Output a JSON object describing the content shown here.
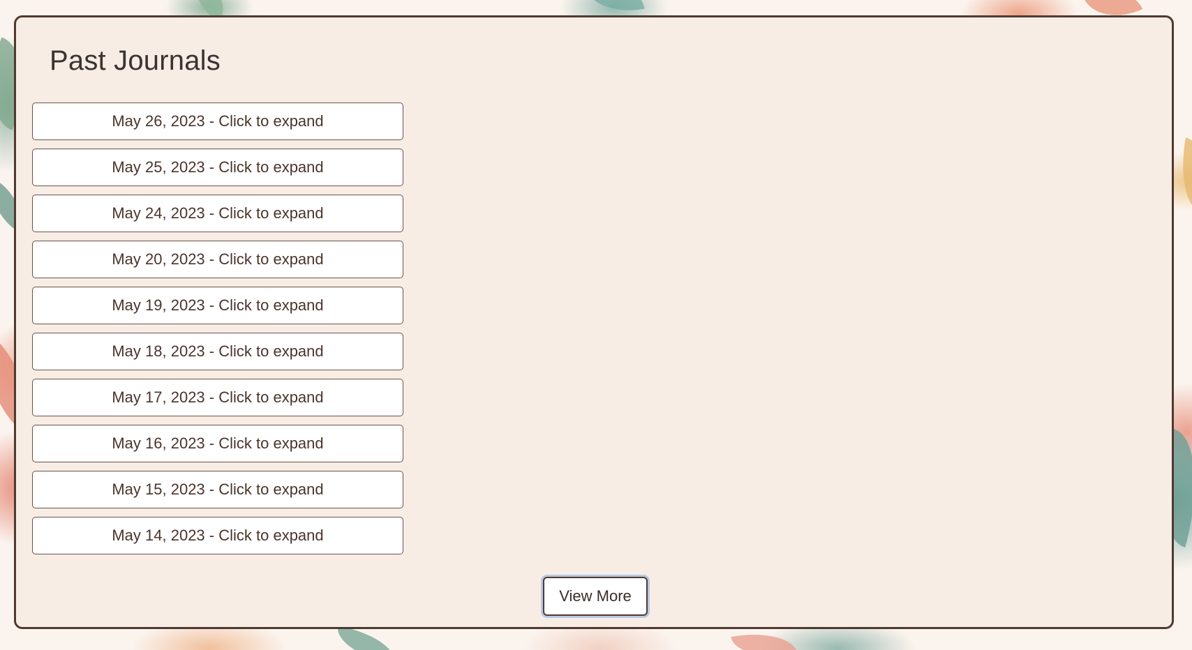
{
  "page": {
    "title": "Past Journals"
  },
  "journals": [
    {
      "label": "May 26, 2023 - Click to expand"
    },
    {
      "label": "May 25, 2023 - Click to expand"
    },
    {
      "label": "May 24, 2023 - Click to expand"
    },
    {
      "label": "May 20, 2023 - Click to expand"
    },
    {
      "label": "May 19, 2023 - Click to expand"
    },
    {
      "label": "May 18, 2023 - Click to expand"
    },
    {
      "label": "May 17, 2023 - Click to expand"
    },
    {
      "label": "May 16, 2023 - Click to expand"
    },
    {
      "label": "May 15, 2023 - Click to expand"
    },
    {
      "label": "May 14, 2023 - Click to expand"
    }
  ],
  "actions": {
    "view_more_label": "View More"
  },
  "colors": {
    "panel_background": "#f8ede4",
    "panel_border": "#4e3a30",
    "button_text": "#4a342c",
    "focus_ring": "#b9c8e4"
  }
}
